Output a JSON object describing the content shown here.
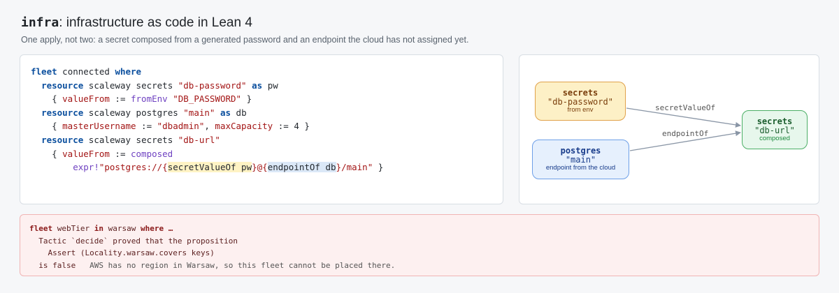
{
  "header": {
    "title_mono": "infra",
    "title_rest": ": infrastructure as code in Lean 4",
    "subtitle": "One apply, not two: a secret composed from a generated password and an endpoint the cloud has not assigned yet."
  },
  "code": {
    "l1": {
      "kw1": "fleet",
      "name": " connected ",
      "kw2": "where"
    },
    "l2": {
      "indent": "  ",
      "kw1": "resource",
      "t1": " scaleway secrets ",
      "s1": "\"db-password\"",
      "t2": " ",
      "kw2": "as",
      "t3": " pw"
    },
    "l3": {
      "indent": "    { ",
      "f1": "valueFrom",
      "t1": " := ",
      "fn1": "fromEnv",
      "t2": " ",
      "s1": "\"DB_PASSWORD\"",
      "t3": " }"
    },
    "l4": {
      "indent": "  ",
      "kw1": "resource",
      "t1": " scaleway postgres ",
      "s1": "\"main\"",
      "t2": " ",
      "kw2": "as",
      "t3": " db"
    },
    "l5": {
      "indent": "    { ",
      "f1": "masterUsername",
      "t1": " := ",
      "s1": "\"dbadmin\"",
      "t2": ", ",
      "f2": "maxCapacity",
      "t3": " := 4 }"
    },
    "l6": {
      "indent": "  ",
      "kw1": "resource",
      "t1": " scaleway secrets ",
      "s1": "\"db-url\""
    },
    "l7": {
      "indent": "    { ",
      "f1": "valueFrom",
      "t1": " := ",
      "fn1": "composed"
    },
    "l8": {
      "indent": "        ",
      "fn1": "expr!",
      "s1": "\"postgres://{",
      "h1": "secretValueOf pw",
      "s2": "}@{",
      "h2": "endpointOf db",
      "s3": "}/main\"",
      "t1": " }"
    }
  },
  "graph": {
    "secret": {
      "kind": "secrets",
      "name": "\"db-password\"",
      "desc": "from env"
    },
    "postgres": {
      "kind": "postgres",
      "name": "\"main\"",
      "desc": "endpoint from the cloud"
    },
    "url": {
      "kind": "secrets",
      "name": "\"db-url\"",
      "desc": "composed"
    },
    "edge1": "secretValueOf",
    "edge2": "endpointOf"
  },
  "error": {
    "l1": {
      "kw1": "fleet",
      "t1": " webTier ",
      "kw2": "in",
      "t2": " warsaw ",
      "kw3": "where …"
    },
    "l2": "  Tactic `decide` proved that the proposition",
    "l3": "    Assert (Locality.warsaw.covers keys)",
    "l4": {
      "t1": "  is false",
      "note": "   AWS has no region in Warsaw, so this fleet cannot be placed there."
    }
  },
  "colors": {
    "keyword": "#0b4f9e",
    "string": "#a31515",
    "secret_node": "#fdf0c6",
    "postgres_node": "#e6f0fd",
    "url_node": "#e7f7ec",
    "error_bg": "#fdf0f0"
  }
}
